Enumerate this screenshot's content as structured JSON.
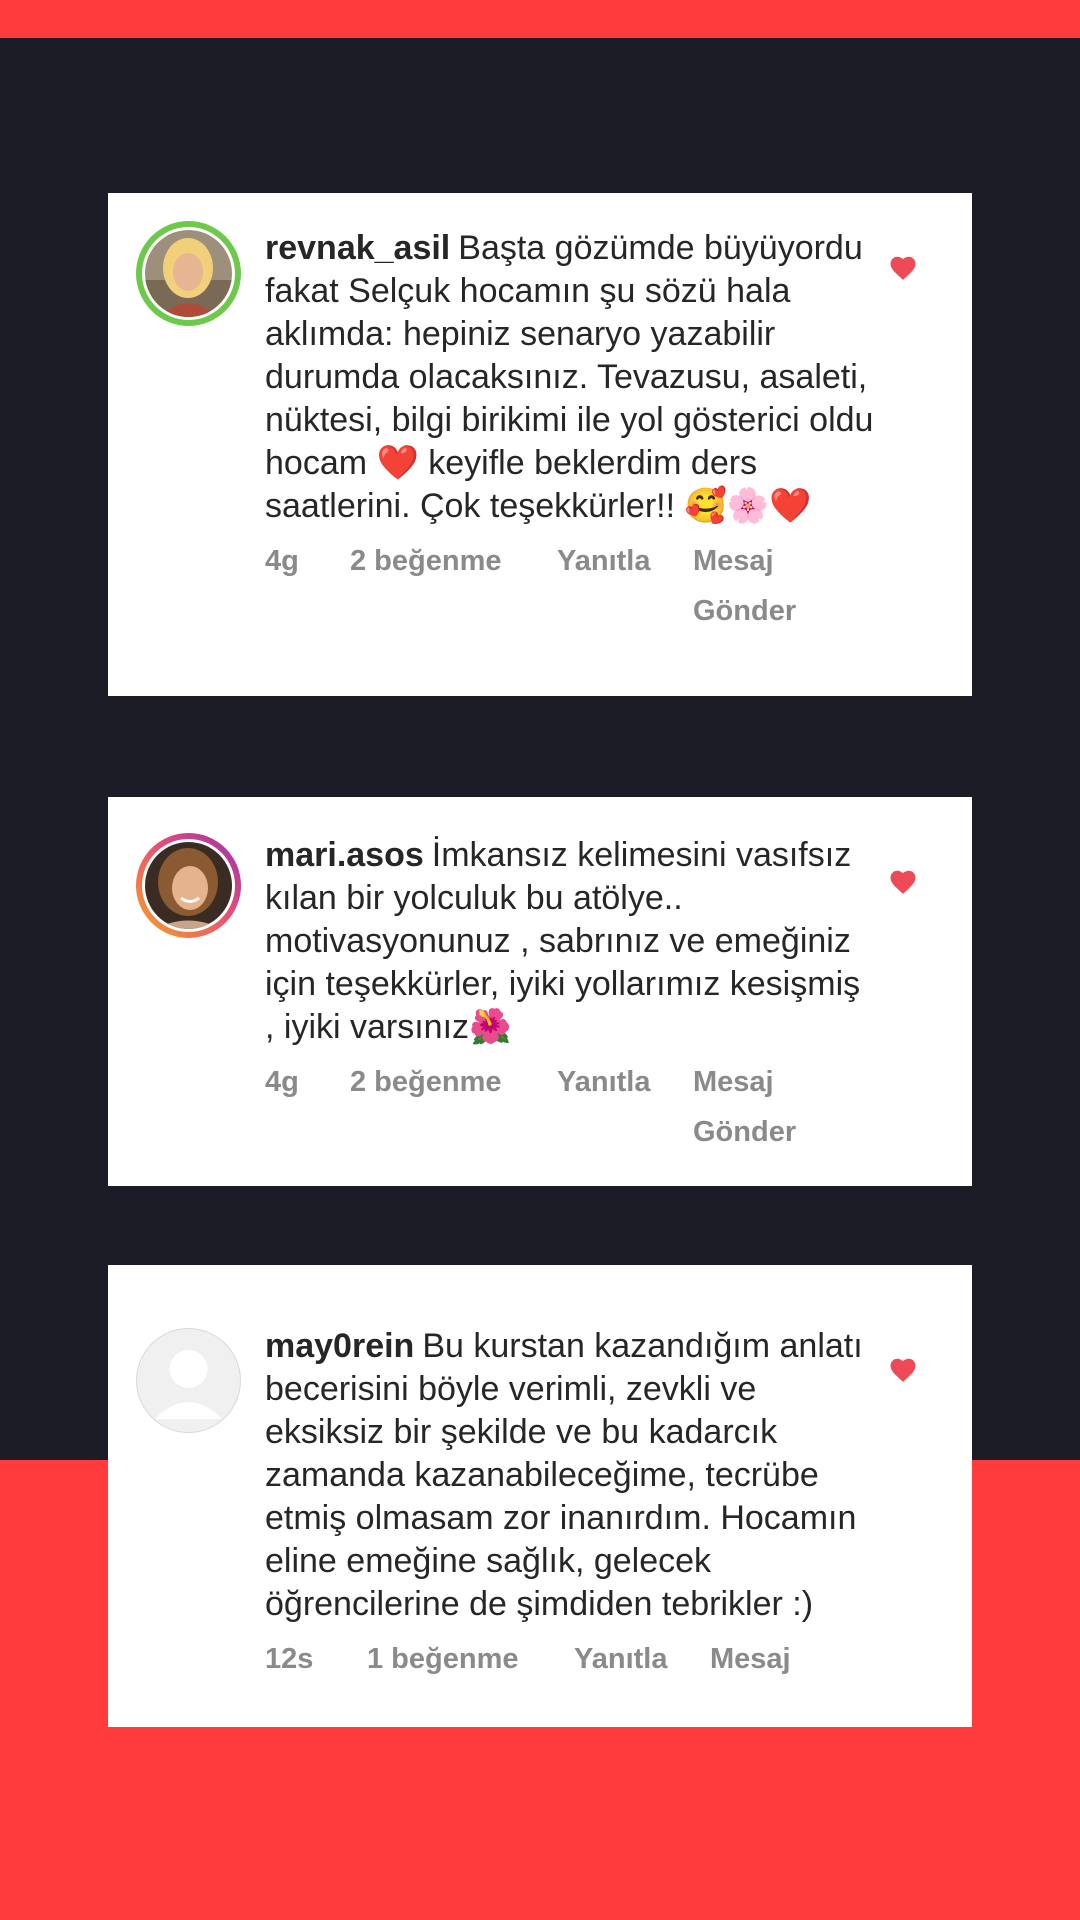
{
  "comments": [
    {
      "username": "revnak_asil",
      "text": "Başta gözümde büyüyordu fakat Selçuk hocamın şu sözü hala aklımda: hepiniz senaryo yazabilir durumda olacaksınız. Tevazusu, asaleti, nüktesi, bilgi birikimi ile yol gösterici oldu hocam ❤️ keyifle beklerdim ders saatlerini. Çok teşekkürler!! 🥰🌸❤️",
      "age": "4g",
      "likes": "2 beğenme",
      "reply": "Yanıtla",
      "send_message": "Mesaj Gönder",
      "avatar_ring": "#6cc94a"
    },
    {
      "username": "mari.asos",
      "text": "İmkansız kelimesini vasıfsız kılan bir yolculuk bu atölye.. motivasyonunuz , sabrınız ve emeğiniz için teşekkürler, iyiki yollarımız kesişmiş , iyiki varsınız🌺",
      "age": "4g",
      "likes": "2 beğenme",
      "reply": "Yanıtla",
      "send_message": "Mesaj Gönder",
      "avatar_ring": "gradient"
    },
    {
      "username": "may0rein",
      "text": "Bu kurstan kazandığım anlatı becerisini böyle verimli, zevkli ve eksiksiz bir şekilde ve bu kadarcık zamanda kazanabileceğime, tecrübe etmiş olmasam zor inanırdım. Hocamın eline emeğine sağlık, gelecek öğrencilerine de şimdiden tebrikler :)",
      "age": "12s",
      "likes": "1 beğenme",
      "reply": "Yanıtla",
      "send_message": "Mesaj",
      "avatar_ring": "none"
    }
  ],
  "icons": {
    "like": "heart-icon",
    "avatar_default": "default-user-icon"
  },
  "colors": {
    "accent_red": "#ff3b3b",
    "background_dark": "#1c1c27",
    "heart": "#ed4956"
  }
}
